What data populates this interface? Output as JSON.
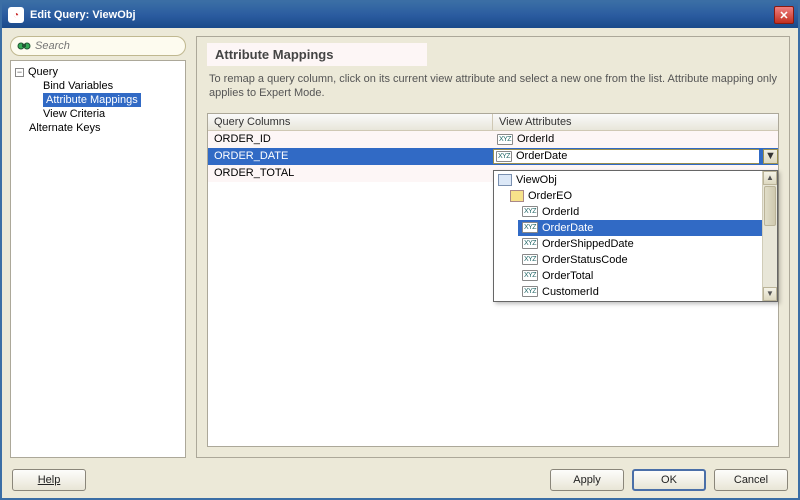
{
  "window": {
    "title": "Edit Query: ViewObj"
  },
  "sidebar": {
    "search_placeholder": "Search",
    "nodes": {
      "query": "Query",
      "bind_vars": "Bind Variables",
      "attr_map": "Attribute Mappings",
      "view_crit": "View Criteria",
      "alt_keys": "Alternate Keys"
    }
  },
  "main": {
    "section_title": "Attribute Mappings",
    "description": "To remap a query column, click on its current view attribute and select a new one from the list.  Attribute mapping only applies to Expert Mode."
  },
  "table": {
    "headers": {
      "col1": "Query Columns",
      "col2": "View Attributes"
    },
    "rows": [
      {
        "qcol": "ORDER_ID",
        "vattr": "OrderId"
      },
      {
        "qcol": "ORDER_DATE",
        "vattr": "OrderDate"
      },
      {
        "qcol": "ORDER_TOTAL",
        "vattr": ""
      }
    ]
  },
  "dropdown": {
    "root": "ViewObj",
    "entity": "OrderEO",
    "attrs": [
      "OrderId",
      "OrderDate",
      "OrderShippedDate",
      "OrderStatusCode",
      "OrderTotal",
      "CustomerId"
    ],
    "selected": "OrderDate"
  },
  "buttons": {
    "help": "Help",
    "apply": "Apply",
    "ok": "OK",
    "cancel": "Cancel"
  }
}
